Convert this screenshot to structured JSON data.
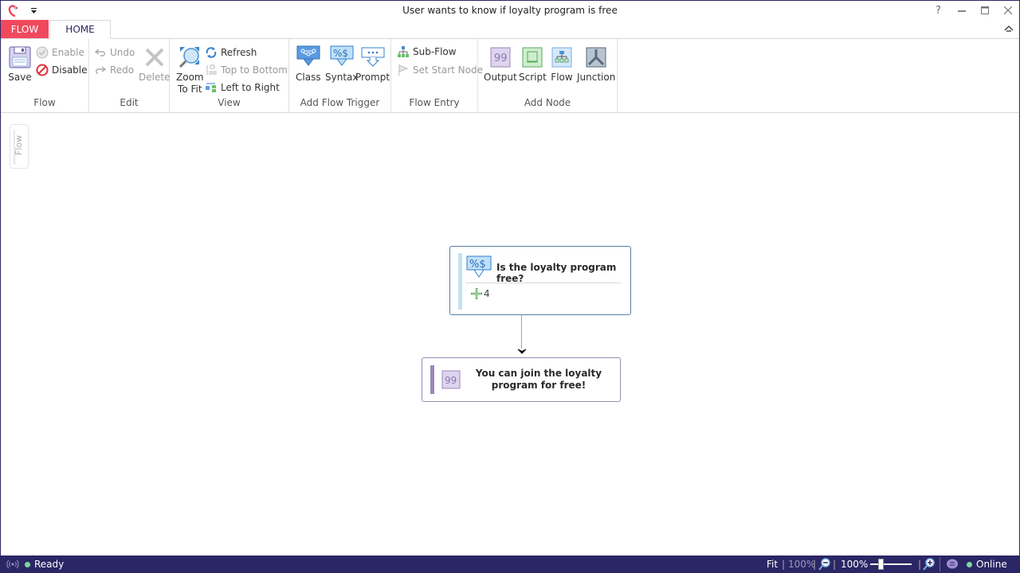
{
  "window": {
    "title": "User wants to know if loyalty program is free",
    "controls": {
      "help": "?",
      "minimize": "—",
      "maximize": "☐",
      "close": "✕"
    }
  },
  "tabs": [
    {
      "label": "FLOW",
      "active": false
    },
    {
      "label": "HOME",
      "active": true
    }
  ],
  "ribbon": {
    "groups": {
      "flow": {
        "label": "Flow",
        "save": "Save",
        "enable": "Enable",
        "disable": "Disable"
      },
      "edit": {
        "label": "Edit",
        "undo": "Undo",
        "redo": "Redo",
        "delete": "Delete"
      },
      "view": {
        "label": "View",
        "zoom_to_fit_line1": "Zoom",
        "zoom_to_fit_line2": "To Fit",
        "refresh": "Refresh",
        "top_to_bottom": "Top to Bottom",
        "left_to_right": "Left to Right"
      },
      "add_flow_trigger": {
        "label": "Add Flow Trigger",
        "class": "Class",
        "syntax": "Syntax",
        "prompt": "Prompt"
      },
      "flow_entry": {
        "label": "Flow Entry",
        "sub_flow": "Sub-Flow",
        "set_start_node": "Set Start Node"
      },
      "add_node": {
        "label": "Add Node",
        "output": "Output",
        "script": "Script",
        "flow": "Flow",
        "junction": "Junction"
      }
    }
  },
  "canvas": {
    "side_tab": "Flow",
    "trigger_node": {
      "title": "Is the loyalty program free?",
      "count": "4",
      "type": "syntax"
    },
    "output_node": {
      "text": "You can join the loyalty program for free!",
      "type": "output"
    }
  },
  "statusbar": {
    "status": "Ready",
    "fit": "Fit",
    "zoom_preset": "100%",
    "zoom_level": "100%",
    "zoom_fraction": 0.5,
    "connection": "Online"
  },
  "colors": {
    "accent": "#f0495e",
    "brand_dark": "#2b2665",
    "status_online": "#7fd69a"
  }
}
